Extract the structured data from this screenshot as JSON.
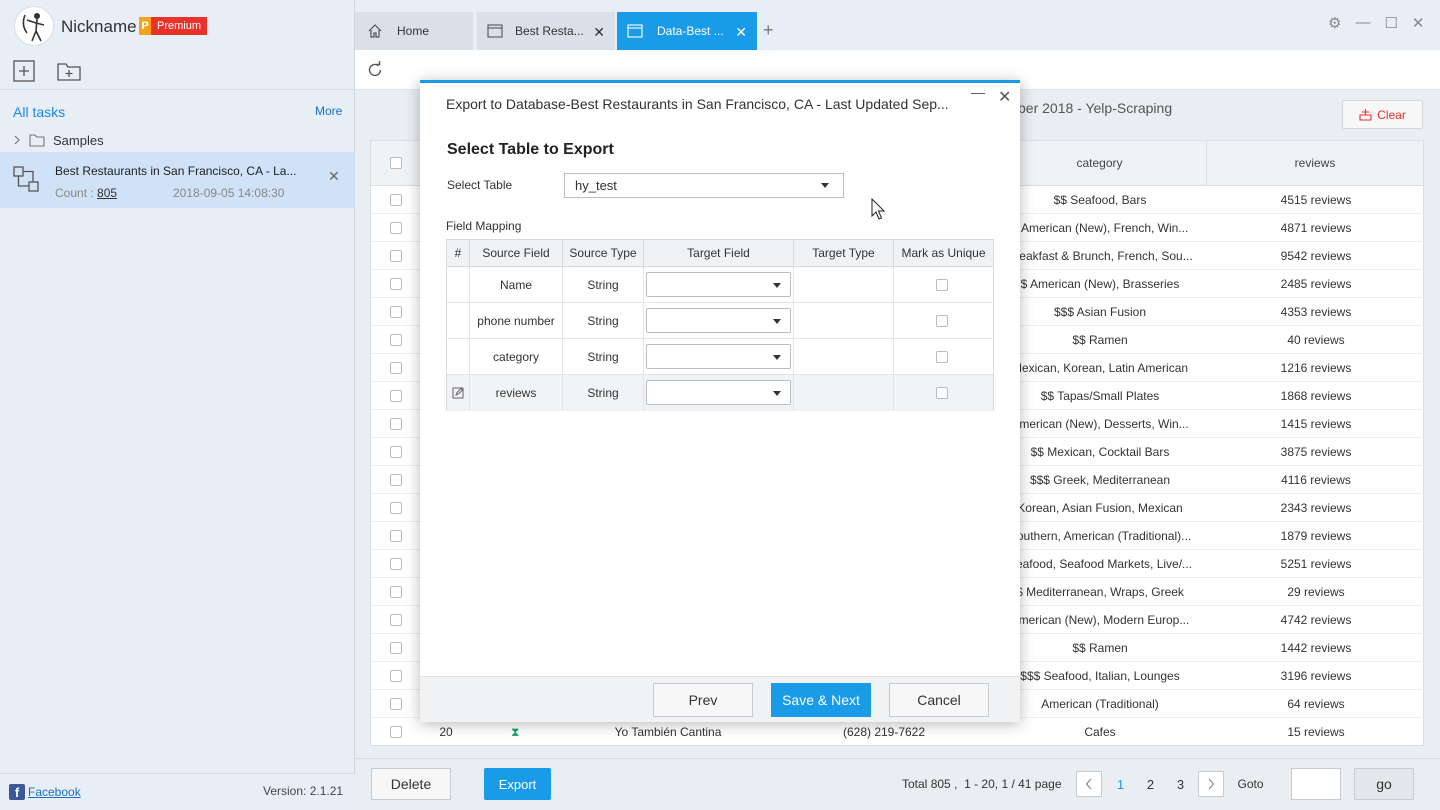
{
  "app": {
    "nickname": "Nickname",
    "premium_p": "P",
    "premium_label": "Premium",
    "version": "Version: 2.1.21",
    "facebook": "Facebook"
  },
  "sidebar": {
    "all_tasks": "All tasks",
    "more": "More",
    "samples": "Samples",
    "task": {
      "title": "Best Restaurants in San Francisco, CA - La...",
      "count_label": "Count : ",
      "count": "805",
      "date": "2018-09-05 14:08:30"
    }
  },
  "tabs": [
    {
      "label": "Home",
      "icon": "home-icon"
    },
    {
      "label": "Best Resta...",
      "icon": "window-icon"
    },
    {
      "label": "Data-Best ...",
      "icon": "window-icon"
    }
  ],
  "main": {
    "title_fragment": "ber 2018 - Yelp-Scraping",
    "clear_label": "Clear",
    "columns": [
      "category",
      "reviews"
    ],
    "rows": [
      {
        "category": "$$ Seafood, Bars",
        "reviews": "4515 reviews"
      },
      {
        "category": "$ American (New), French, Win...",
        "reviews": "4871 reviews"
      },
      {
        "category": "Breakfast & Brunch, French, Sou...",
        "reviews": "9542 reviews"
      },
      {
        "category": "$ American (New), Brasseries",
        "reviews": "2485 reviews"
      },
      {
        "category": "$$$ Asian Fusion",
        "reviews": "4353 reviews"
      },
      {
        "category": "$$ Ramen",
        "reviews": "40 reviews"
      },
      {
        "category": "Mexican, Korean, Latin American",
        "reviews": "1216 reviews"
      },
      {
        "category": "$$ Tapas/Small Plates",
        "reviews": "1868 reviews"
      },
      {
        "category": "American (New), Desserts, Win...",
        "reviews": "1415 reviews"
      },
      {
        "category": "$$ Mexican, Cocktail Bars",
        "reviews": "3875 reviews"
      },
      {
        "category": "$$$ Greek, Mediterranean",
        "reviews": "4116 reviews"
      },
      {
        "category": "Korean, Asian Fusion, Mexican",
        "reviews": "2343 reviews"
      },
      {
        "category": "Southern, American (Traditional)...",
        "reviews": "1879 reviews"
      },
      {
        "category": "Seafood, Seafood Markets, Live/...",
        "reviews": "5251 reviews"
      },
      {
        "category": "$ Mediterranean, Wraps, Greek",
        "reviews": "29 reviews"
      },
      {
        "category": "American (New), Modern Europ...",
        "reviews": "4742 reviews"
      },
      {
        "category": "$$ Ramen",
        "reviews": "1442 reviews"
      },
      {
        "category": "$$$ Seafood, Italian, Lounges",
        "reviews": "3196 reviews"
      },
      {
        "category": "American (Traditional)",
        "reviews": "64 reviews"
      }
    ],
    "last_row": {
      "num": "20",
      "name": "Yo También Cantina",
      "phone": "(628) 219-7622",
      "category": "Cafes",
      "reviews": "15 reviews"
    }
  },
  "bottom": {
    "delete": "Delete",
    "export": "Export",
    "pager": {
      "total_label": "Total",
      "total": "805",
      "range": "1 - 20,",
      "page_of": "1 / 41 page",
      "pages": [
        "1",
        "2",
        "3"
      ],
      "goto": "Goto",
      "go": "go"
    }
  },
  "modal": {
    "title": "Export to Database-Best Restaurants in San Francisco, CA - Last Updated Sep...",
    "heading": "Select Table to Export",
    "select_label": "Select Table",
    "select_value": "hy_test",
    "field_mapping": "Field Mapping",
    "columns": [
      "#",
      "Source Field",
      "Source Type",
      "Target Field",
      "Target Type",
      "Mark as Unique"
    ],
    "rows": [
      {
        "source": "Name",
        "type": "String"
      },
      {
        "source": "phone number",
        "type": "String"
      },
      {
        "source": "category",
        "type": "String"
      },
      {
        "source": "reviews",
        "type": "String"
      }
    ],
    "prev": "Prev",
    "save_next": "Save & Next",
    "cancel": "Cancel"
  },
  "colors": {
    "accent": "#1a9be8",
    "premium": "#e8322a"
  }
}
